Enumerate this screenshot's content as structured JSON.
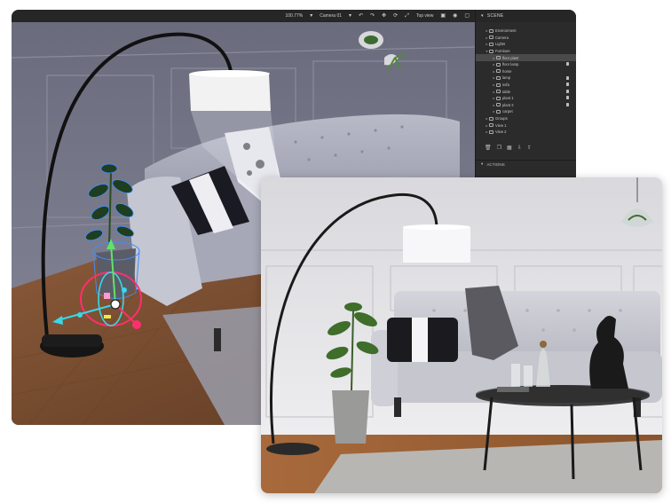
{
  "toolbar": {
    "zoom": "100.77%",
    "camera": "Camera 01",
    "mode": "Top view",
    "icons": [
      "undo-icon",
      "redo-icon",
      "move-icon",
      "rotate-icon",
      "scale-icon",
      "frame-icon",
      "camera-icon",
      "render-icon"
    ]
  },
  "scene_panel": {
    "title": "SCENE",
    "items": [
      {
        "label": "Environment",
        "indent": 0,
        "locked": false,
        "selected": false
      },
      {
        "label": "Camera",
        "indent": 0,
        "locked": false,
        "selected": false
      },
      {
        "label": "Lights",
        "indent": 0,
        "locked": false,
        "selected": false
      },
      {
        "label": "Furniture",
        "indent": 0,
        "locked": false,
        "selected": false
      },
      {
        "label": "floor plant",
        "indent": 1,
        "locked": false,
        "selected": true
      },
      {
        "label": "floor lamp",
        "indent": 1,
        "locked": true,
        "selected": false
      },
      {
        "label": "horse",
        "indent": 1,
        "locked": false,
        "selected": false
      },
      {
        "label": "lamp",
        "indent": 1,
        "locked": true,
        "selected": false
      },
      {
        "label": "sofa",
        "indent": 1,
        "locked": true,
        "selected": false
      },
      {
        "label": "table",
        "indent": 1,
        "locked": true,
        "selected": false
      },
      {
        "label": "plant 1",
        "indent": 1,
        "locked": true,
        "selected": false
      },
      {
        "label": "plant 2",
        "indent": 1,
        "locked": true,
        "selected": false
      },
      {
        "label": "carpet",
        "indent": 1,
        "locked": false,
        "selected": false
      },
      {
        "label": "Groups",
        "indent": 0,
        "locked": false,
        "selected": false
      },
      {
        "label": "View 1",
        "indent": 0,
        "locked": false,
        "selected": false
      },
      {
        "label": "View 2",
        "indent": 0,
        "locked": false,
        "selected": false
      }
    ],
    "tool_icons": [
      "trash-icon",
      "duplicate-icon",
      "group-icon",
      "export-icon",
      "import-icon"
    ],
    "actions_title": "ACTIONS"
  },
  "colors": {
    "panel_bg": "#2b2b2b",
    "toolbar_bg": "#262626",
    "gizmo_green": "#5fe36a",
    "gizmo_blue": "#3f8cff",
    "gizmo_red": "#ff2f6e",
    "gizmo_cyan": "#39d8e8"
  }
}
